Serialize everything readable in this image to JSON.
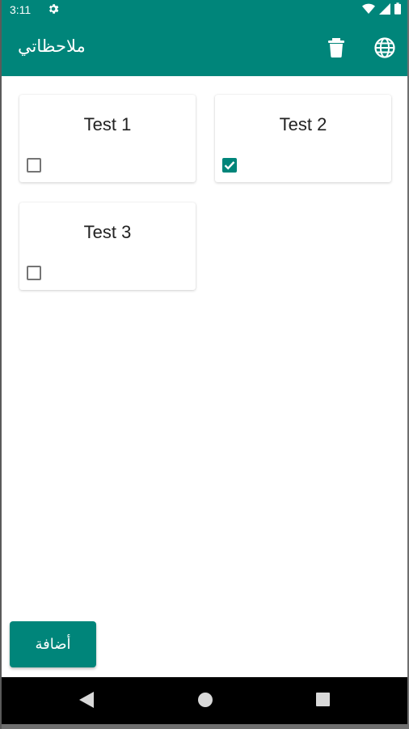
{
  "status_bar": {
    "time": "3:11",
    "icons": [
      "gear-icon",
      "wifi-icon",
      "signal-icon",
      "battery-icon"
    ]
  },
  "app_bar": {
    "title": "ملاحظاتي",
    "actions": [
      "delete-icon",
      "globe-icon"
    ]
  },
  "notes": [
    {
      "title": "Test 1",
      "checked": false
    },
    {
      "title": "Test 2",
      "checked": true
    },
    {
      "title": "Test 3",
      "checked": false
    }
  ],
  "add_button": {
    "label": "أضافة"
  },
  "nav_bar": {
    "buttons": [
      "back-icon",
      "home-icon",
      "recents-icon"
    ]
  },
  "colors": {
    "primary": "#00857a",
    "background": "#ffffff",
    "nav": "#000000"
  }
}
